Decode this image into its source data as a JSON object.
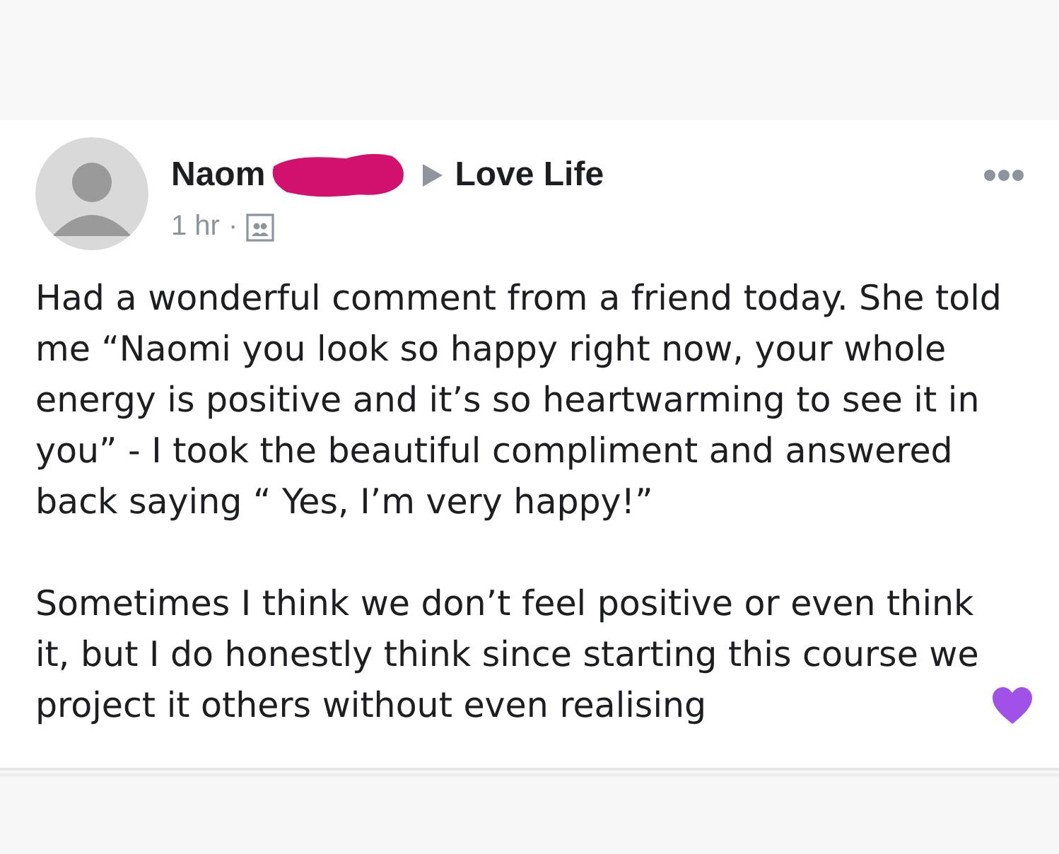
{
  "post": {
    "author": "Naom",
    "group": "Love Life",
    "time": "1 hr",
    "separator": "·",
    "paragraphs": [
      "Had a wonderful comment from a friend today. She told me “Naomi you look so happy right now, your whole energy is positive and it’s so heartwarming to see it in you” - I took the beautiful compliment and answered back saying “ Yes, I’m very happy!”",
      "Sometimes I think we don’t feel positive or even think it, but I do honestly think since starting this course we project it others without even realising"
    ]
  }
}
